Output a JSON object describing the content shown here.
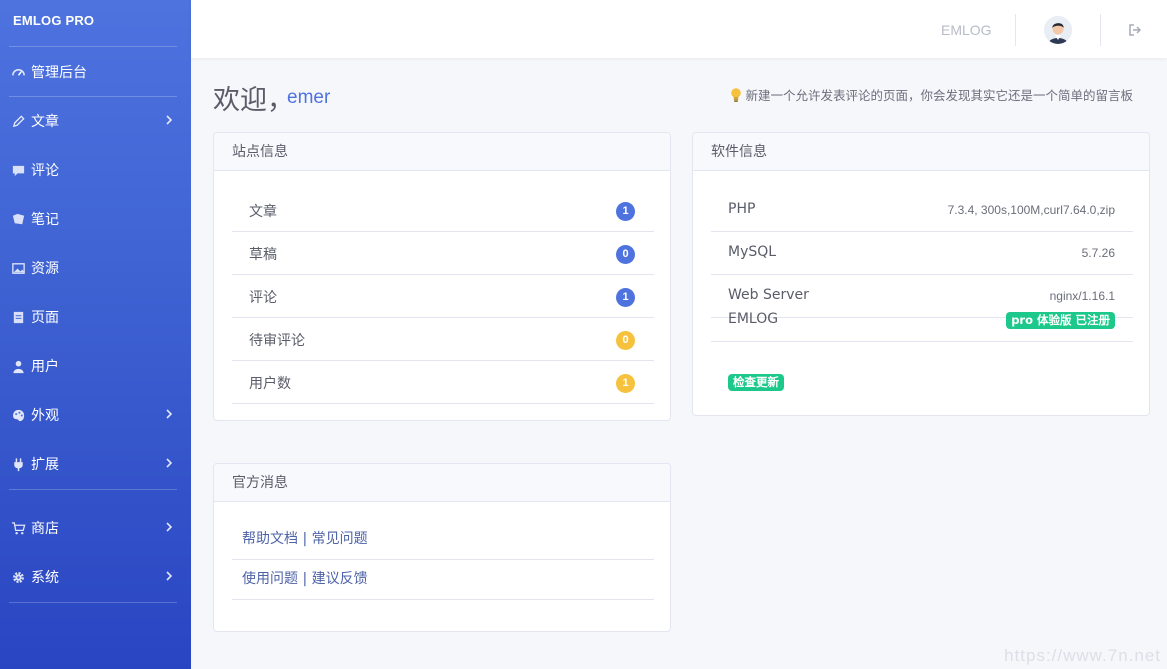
{
  "brand": "EMLOG PRO",
  "sidebar": {
    "dashboard": "管理后台",
    "items": [
      {
        "label": "文章",
        "icon": "pencil-icon",
        "has_submenu": true
      },
      {
        "label": "评论",
        "icon": "comment-icon",
        "has_submenu": false
      },
      {
        "label": "笔记",
        "icon": "note-icon",
        "has_submenu": false
      },
      {
        "label": "资源",
        "icon": "image-icon",
        "has_submenu": false
      },
      {
        "label": "页面",
        "icon": "page-icon",
        "has_submenu": false
      },
      {
        "label": "用户",
        "icon": "user-icon",
        "has_submenu": false
      },
      {
        "label": "外观",
        "icon": "palette-icon",
        "has_submenu": true
      },
      {
        "label": "扩展",
        "icon": "plug-icon",
        "has_submenu": true
      }
    ],
    "items2": [
      {
        "label": "商店",
        "icon": "cart-icon",
        "has_submenu": true
      },
      {
        "label": "系统",
        "icon": "gear-icon",
        "has_submenu": true
      }
    ]
  },
  "topbar": {
    "site_name": "EMLOG"
  },
  "welcome": {
    "greeting": "欢迎，",
    "username": "emer"
  },
  "tip": "新建一个允许发表评论的页面，你会发现其实它还是一个简单的留言板",
  "site_info": {
    "title": "站点信息",
    "rows": [
      {
        "label": "文章",
        "count": "1",
        "color": "#4e73df"
      },
      {
        "label": "草稿",
        "count": "0",
        "color": "#4e73df"
      },
      {
        "label": "评论",
        "count": "1",
        "color": "#4e73df"
      },
      {
        "label": "待审评论",
        "count": "0",
        "color": "#f6c23e"
      },
      {
        "label": "用户数",
        "count": "1",
        "color": "#f6c23e"
      }
    ]
  },
  "software_info": {
    "title": "软件信息",
    "rows": [
      {
        "label": "PHP",
        "value": "7.3.4, 300s,100M,curl7.64.0,zip"
      },
      {
        "label": "MySQL",
        "value": "5.7.26"
      },
      {
        "label": "Web Server",
        "value": "nginx/1.16.1"
      }
    ],
    "emlog_label": "EMLOG",
    "emlog_badge": "pro 体验版 已注册",
    "check_update": "检查更新"
  },
  "news": {
    "title": "官方消息",
    "links": [
      {
        "a": "帮助文档",
        "b": "常见问题"
      },
      {
        "a": "使用问题",
        "b": "建议反馈"
      }
    ],
    "separator": " | "
  },
  "watermark": "https://www.7n.net",
  "colors": {
    "sidebar": "#4e73df",
    "primary": "#4e73df",
    "warning": "#f6c23e",
    "success": "#1cc88a"
  }
}
